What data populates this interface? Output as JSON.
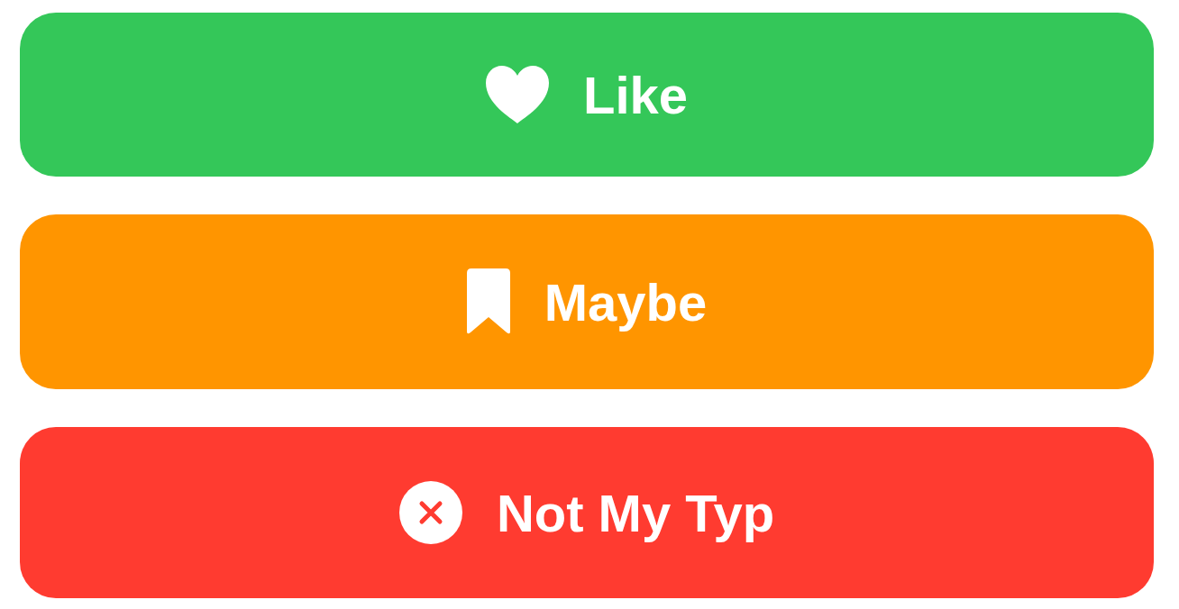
{
  "buttons": [
    {
      "label": "Like",
      "kind": "heart",
      "color": "#34c759"
    },
    {
      "label": "Maybe",
      "kind": "bookmark",
      "color": "#ff9500"
    },
    {
      "label": "Not My Typ",
      "kind": "xmark",
      "color": "#ff3b30"
    }
  ]
}
